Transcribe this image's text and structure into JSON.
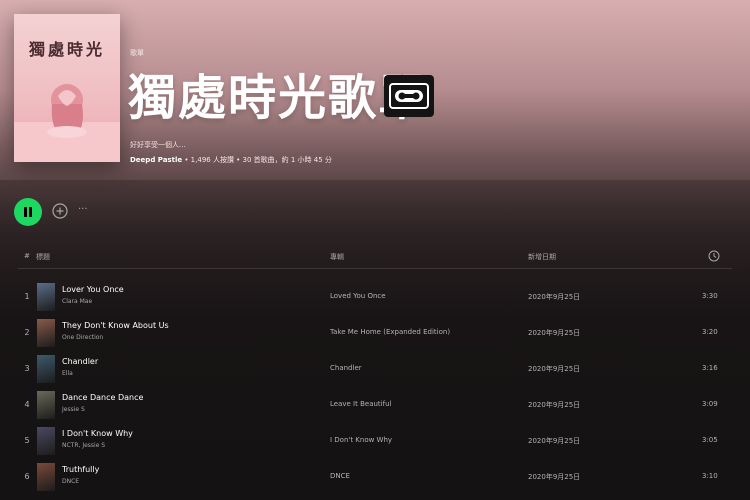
{
  "playlist": {
    "cover_title": "獨處時光",
    "type_label": "歌單",
    "title": "獨處時光歌單",
    "description": "好好享受一個人...",
    "owner": "Deepd Pastle",
    "meta_details": "• 1,496 人按讚 • 30 首歌曲，約 1 小時 45 分"
  },
  "colors": {
    "accent": "#1ed760",
    "header_top": "#d8aeb0",
    "background": "#121212"
  },
  "actions": {
    "more": "···"
  },
  "table": {
    "header": {
      "num": "#",
      "title": "標題",
      "album": "專輯",
      "date_added": "新增日期"
    },
    "rows": [
      {
        "num": "1",
        "title": "Lover You Once",
        "artist": "Clara Mae",
        "album": "Loved You Once",
        "date": "2020年9月25日",
        "duration": "3:30",
        "thumb": "#5a6f8a"
      },
      {
        "num": "2",
        "title": "They Don't Know About Us",
        "artist": "One Direction",
        "album": "Take Me Home (Expanded Edition)",
        "date": "2020年9月25日",
        "duration": "3:20",
        "thumb": "#8a5a4a"
      },
      {
        "num": "3",
        "title": "Chandler",
        "artist": "Ella",
        "album": "Chandler",
        "date": "2020年9月25日",
        "duration": "3:16",
        "thumb": "#3e5a6e"
      },
      {
        "num": "4",
        "title": "Dance Dance Dance",
        "artist": "Jessie S",
        "album": "Leave It Beautiful",
        "date": "2020年9月25日",
        "duration": "3:09",
        "thumb": "#6a6a5a"
      },
      {
        "num": "5",
        "title": "I Don't Know Why",
        "artist": "NCTR, Jessie S",
        "album": "I Don't Know Why",
        "date": "2020年9月25日",
        "duration": "3:05",
        "thumb": "#4a4a62"
      },
      {
        "num": "6",
        "title": "Truthfully",
        "artist": "DNCE",
        "album": "DNCE",
        "date": "2020年9月25日",
        "duration": "3:10",
        "thumb": "#7a4a3a"
      }
    ]
  }
}
